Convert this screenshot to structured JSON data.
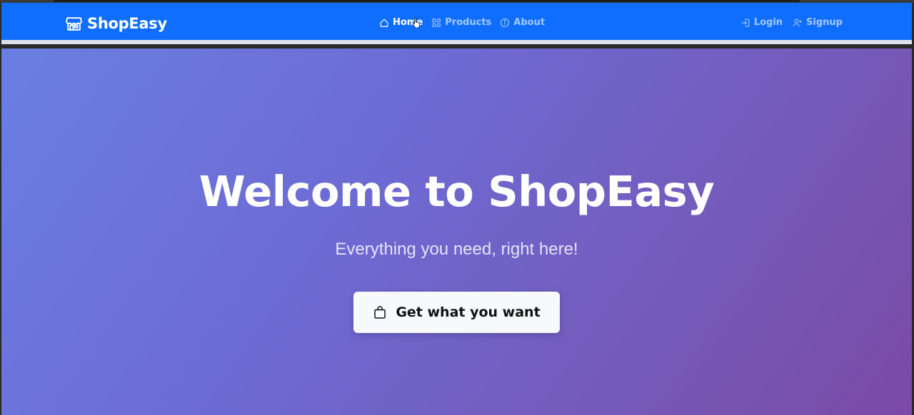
{
  "brand": {
    "name": "ShopEasy",
    "icon": "shop-icon"
  },
  "nav": {
    "center": [
      {
        "label": "Home",
        "icon": "house-icon",
        "active": true
      },
      {
        "label": "Products",
        "icon": "grid-icon",
        "active": false
      },
      {
        "label": "About",
        "icon": "info-circle-icon",
        "active": false
      }
    ],
    "right": [
      {
        "label": "Login",
        "icon": "login-icon"
      },
      {
        "label": "Signup",
        "icon": "person-plus-icon"
      }
    ]
  },
  "hero": {
    "title": "Welcome to ShopEasy",
    "subtitle": "Everything you need, right here!",
    "cta_label": "Get what you want",
    "cta_icon": "bag-icon"
  },
  "colors": {
    "navbar": "#0f6efd",
    "hero_gradient_start": "#6a7fe2",
    "hero_gradient_end": "#7b4aa6",
    "cta_background": "#f8f9fa"
  }
}
